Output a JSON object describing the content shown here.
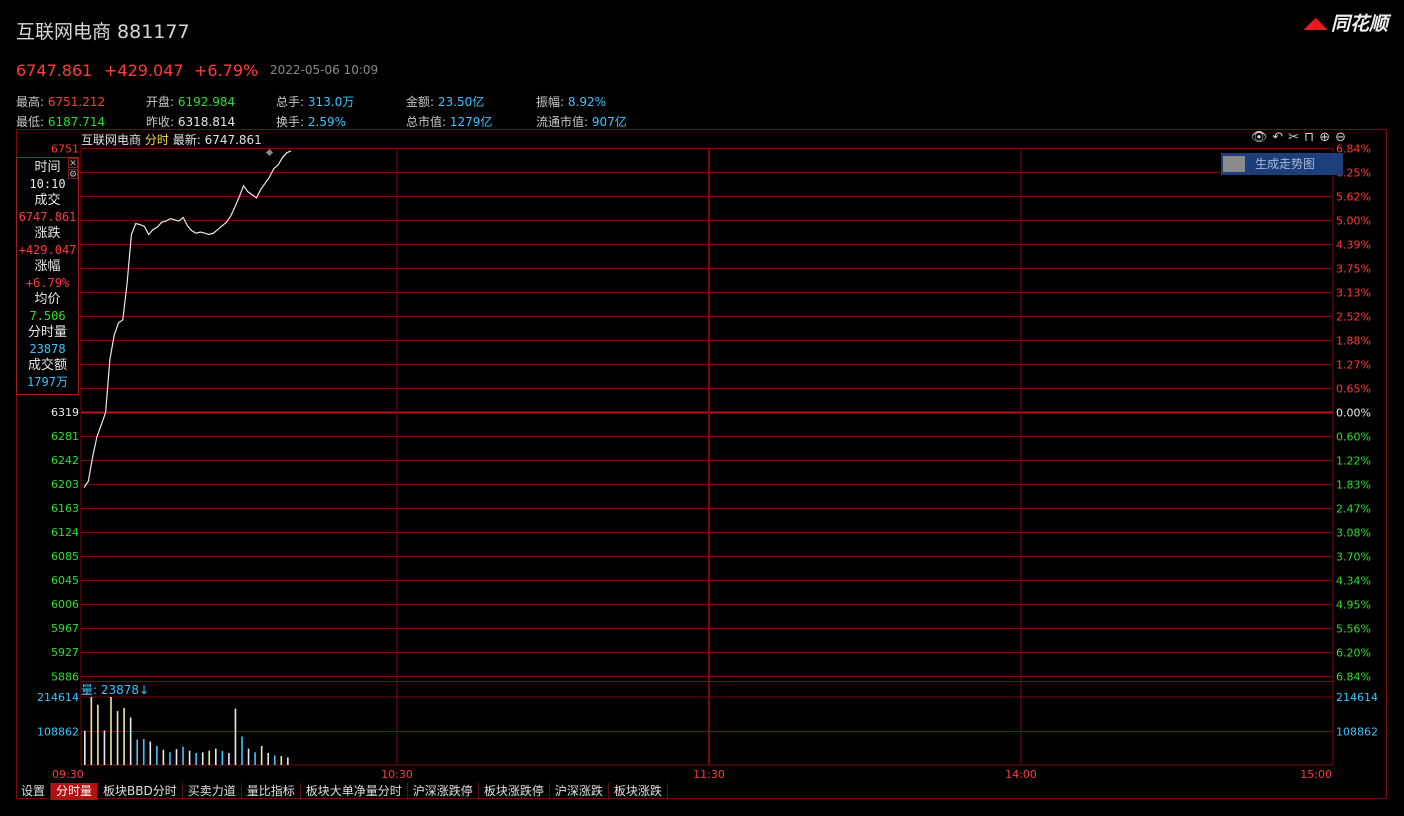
{
  "header": {
    "title": "互联网电商 881177",
    "logo_text": "同花顺",
    "price": "6747.861",
    "change": "+429.047",
    "change_pct": "+6.79%",
    "datetime": "2022-05-06 10:09"
  },
  "stats": {
    "row1": [
      {
        "label": "最高:",
        "value": "6751.212",
        "color": "red"
      },
      {
        "label": "开盘:",
        "value": "6192.984",
        "color": "green"
      },
      {
        "label": "总手:",
        "value": "313.0万",
        "color": "cyan"
      },
      {
        "label": "金额:",
        "value": "23.50亿",
        "color": "cyan"
      },
      {
        "label": "振幅:",
        "value": "8.92%",
        "color": "cyan"
      }
    ],
    "row2": [
      {
        "label": "最低:",
        "value": "6187.714",
        "color": "green"
      },
      {
        "label": "昨收:",
        "value": "6318.814",
        "color": "white"
      },
      {
        "label": "换手:",
        "value": "2.59%",
        "color": "cyan"
      },
      {
        "label": "总市值:",
        "value": "1279亿",
        "color": "cyan"
      },
      {
        "label": "流通市值:",
        "value": "907亿",
        "color": "cyan"
      }
    ]
  },
  "chart_header": {
    "name": "互联网电商",
    "mode": "分时",
    "latest_label": "最新:",
    "latest_value": "6747.861"
  },
  "toolbar_icons": [
    "eye-icon",
    "undo-icon",
    "scissors-icon",
    "lock-icon",
    "zoom-in-icon",
    "zoom-out-icon"
  ],
  "trend_button_label": "生成走势图",
  "infobox": {
    "time_label": "时间",
    "time_value": "10:10",
    "deal_label": "成交",
    "deal_value": "6747.861",
    "change_label": "涨跌",
    "change_value": "+429.047",
    "pct_label": "涨幅",
    "pct_value": "+6.79%",
    "avg_label": "均价",
    "avg_value": "7.506",
    "vol_label": "分时量",
    "vol_value": "23878",
    "amount_label": "成交额",
    "amount_value": "1797万"
  },
  "volume_header": "量: 23878↓",
  "colors": {
    "up": "#ff3a3a",
    "down": "#2adf2a",
    "grid": "#7a0b0b",
    "price_line": "#e8e8e8",
    "volume_up": "#f0e6a0",
    "volume_down": "#3cc4ff",
    "baseline": "#c01010"
  },
  "chart_data": {
    "type": "line",
    "y_left_ticks": [
      "6751",
      "6319",
      "6281",
      "6242",
      "6203",
      "6163",
      "6124",
      "6085",
      "6045",
      "6006",
      "5967",
      "5927",
      "5886"
    ],
    "y_right_ticks": [
      "6.84%",
      "6.25%",
      "5.62%",
      "5.00%",
      "4.39%",
      "3.75%",
      "3.13%",
      "2.52%",
      "1.88%",
      "1.27%",
      "0.65%",
      "0.00%",
      "0.60%",
      "1.22%",
      "1.83%",
      "2.47%",
      "3.08%",
      "3.70%",
      "4.34%",
      "4.95%",
      "5.56%",
      "6.20%",
      "6.84%"
    ],
    "volume_ticks": [
      "214614",
      "108862"
    ],
    "x_ticks": [
      "09:30",
      "10:30",
      "11:30",
      "14:00",
      "15:00"
    ],
    "prev_close": 6318.814,
    "ylim": [
      5886,
      6751
    ],
    "price": [
      6195,
      6205,
      6245,
      6278,
      6298,
      6318,
      6405,
      6445,
      6465,
      6470,
      6530,
      6610,
      6628,
      6626,
      6623,
      6610,
      6618,
      6622,
      6630,
      6632,
      6636,
      6634,
      6632,
      6638,
      6624,
      6616,
      6612,
      6614,
      6612,
      6610,
      6612,
      6618,
      6624,
      6630,
      6640,
      6655,
      6672,
      6690,
      6680,
      6675,
      6670,
      6684,
      6694,
      6704,
      6718,
      6724,
      6736,
      6744,
      6747
    ],
    "volume": [
      108000,
      214614,
      190000,
      108862,
      214614,
      170000,
      180000,
      150000,
      80000,
      82000,
      74000,
      60000,
      48000,
      40000,
      50000,
      58000,
      45000,
      38000,
      40000,
      45000,
      52000,
      44000,
      38000,
      178000,
      90000,
      52000,
      40000,
      60000,
      38000,
      30000,
      28000,
      24000
    ],
    "volume_colors": [
      "white",
      "yellow",
      "yellow",
      "white",
      "yellow",
      "yellow",
      "yellow",
      "white",
      "cyan",
      "cyan",
      "white",
      "cyan",
      "white",
      "cyan",
      "white",
      "cyan",
      "white",
      "cyan",
      "white",
      "yellow",
      "white",
      "cyan",
      "white",
      "white",
      "cyan",
      "white",
      "cyan",
      "yellow",
      "white",
      "cyan",
      "yellow",
      "white"
    ]
  },
  "tabs": [
    {
      "label": "设置",
      "active": false
    },
    {
      "label": "分时量",
      "active": true
    },
    {
      "label": "板块BBD分时",
      "active": false
    },
    {
      "label": "买卖力道",
      "active": false
    },
    {
      "label": "量比指标",
      "active": false
    },
    {
      "label": "板块大单净量分时",
      "active": false
    },
    {
      "label": "沪深涨跌停",
      "active": false
    },
    {
      "label": "板块涨跌停",
      "active": false
    },
    {
      "label": "沪深涨跌",
      "active": false
    },
    {
      "label": "板块涨跌",
      "active": false
    }
  ]
}
